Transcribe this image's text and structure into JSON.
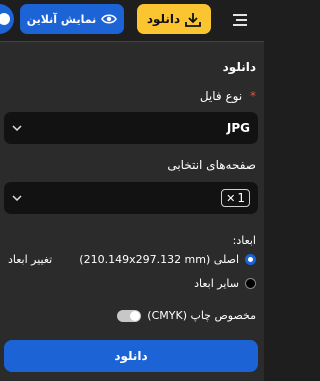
{
  "header": {
    "download_label": "دانلود",
    "online_view_label": "نمایش آنلاین",
    "icons": {
      "menu": "hamburger-icon",
      "download": "download-icon",
      "view": "eye-icon"
    }
  },
  "panel": {
    "title": "دانلود",
    "file_type": {
      "label": "نوع فایل",
      "required_mark": "*",
      "value": "JPG"
    },
    "pages": {
      "label": "صفحه‌های انتخابی",
      "selected_tag": "1"
    },
    "dimensions": {
      "label": "ابعاد:",
      "options": [
        {
          "label": "اصلی (210.149x297.132 mm)",
          "selected": true
        },
        {
          "label": "سایر ابعاد",
          "selected": false
        }
      ],
      "change_label": "تغییر ابعاد"
    },
    "cmyk": {
      "label": "مخصوص چاپ (CMYK)",
      "enabled": false
    },
    "download_button": "دانلود"
  },
  "colors": {
    "accent": "#1c63d6",
    "yellow": "#fbc431",
    "background": "#2b2b2b",
    "required": "#e0553d"
  }
}
